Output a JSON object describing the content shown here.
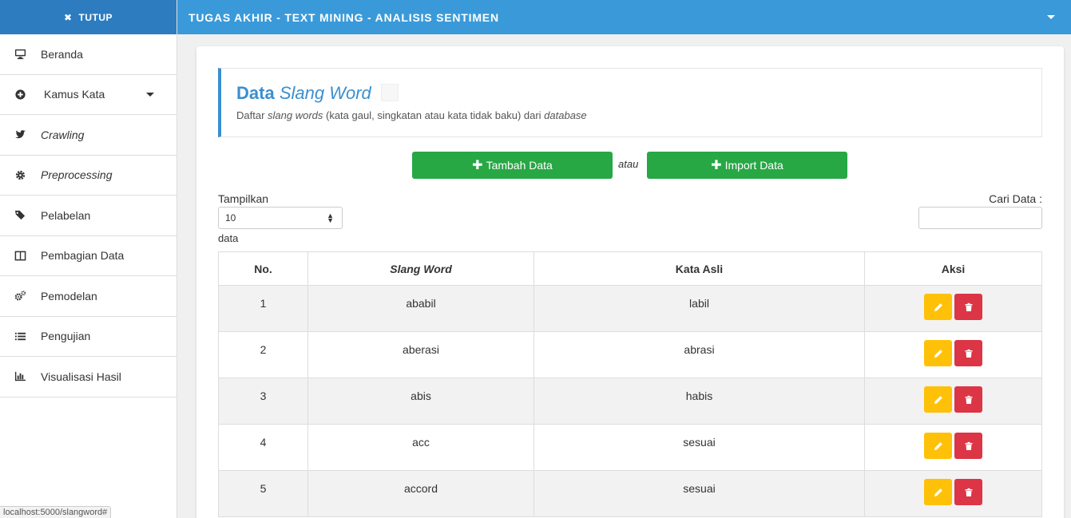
{
  "sidebar": {
    "close_label": "TUTUP",
    "items": [
      {
        "label": "Beranda",
        "icon": "desktop-icon"
      },
      {
        "label": "Kamus Kata",
        "icon": "plus-circle-icon"
      },
      {
        "label": "Crawling",
        "icon": "twitter-icon"
      },
      {
        "label": "Preprocessing",
        "icon": "gear-icon"
      },
      {
        "label": "Pelabelan",
        "icon": "tags-icon"
      },
      {
        "label": "Pembagian Data",
        "icon": "columns-icon"
      },
      {
        "label": "Pemodelan",
        "icon": "gears-icon"
      },
      {
        "label": "Pengujian",
        "icon": "list-icon"
      },
      {
        "label": "Visualisasi Hasil",
        "icon": "bar-chart-icon"
      }
    ],
    "status_url": "localhost:5000/slangword#"
  },
  "header": {
    "title": "TUGAS AKHIR - TEXT MINING - ANALISIS SENTIMEN"
  },
  "page": {
    "title_bold": "Data",
    "title_italic": "Slang Word",
    "subtitle_pre": "Daftar ",
    "subtitle_it1": "slang words",
    "subtitle_mid": " (kata gaul, singkatan atau kata tidak baku) dari ",
    "subtitle_it2": "database"
  },
  "actions": {
    "add_label": "Tambah Data",
    "or_label": "atau",
    "import_label": "Import Data"
  },
  "controls": {
    "show_label": "Tampilkan",
    "page_size": "10",
    "data_label": "data",
    "search_label": "Cari Data :"
  },
  "table": {
    "headers": [
      "No.",
      "Slang Word",
      "Kata Asli",
      "Aksi"
    ],
    "rows": [
      {
        "no": "1",
        "slang": "ababil",
        "asli": "labil"
      },
      {
        "no": "2",
        "slang": "aberasi",
        "asli": "abrasi"
      },
      {
        "no": "3",
        "slang": "abis",
        "asli": "habis"
      },
      {
        "no": "4",
        "slang": "acc",
        "asli": "sesuai"
      },
      {
        "no": "5",
        "slang": "accord",
        "asli": "sesuai"
      }
    ]
  },
  "colors": {
    "topbar": "#3a9ad9",
    "sidebar_top": "#2d7cc0",
    "accent": "#3a8fd0",
    "green": "#28a745",
    "edit": "#ffc107",
    "delete": "#dc3545"
  }
}
